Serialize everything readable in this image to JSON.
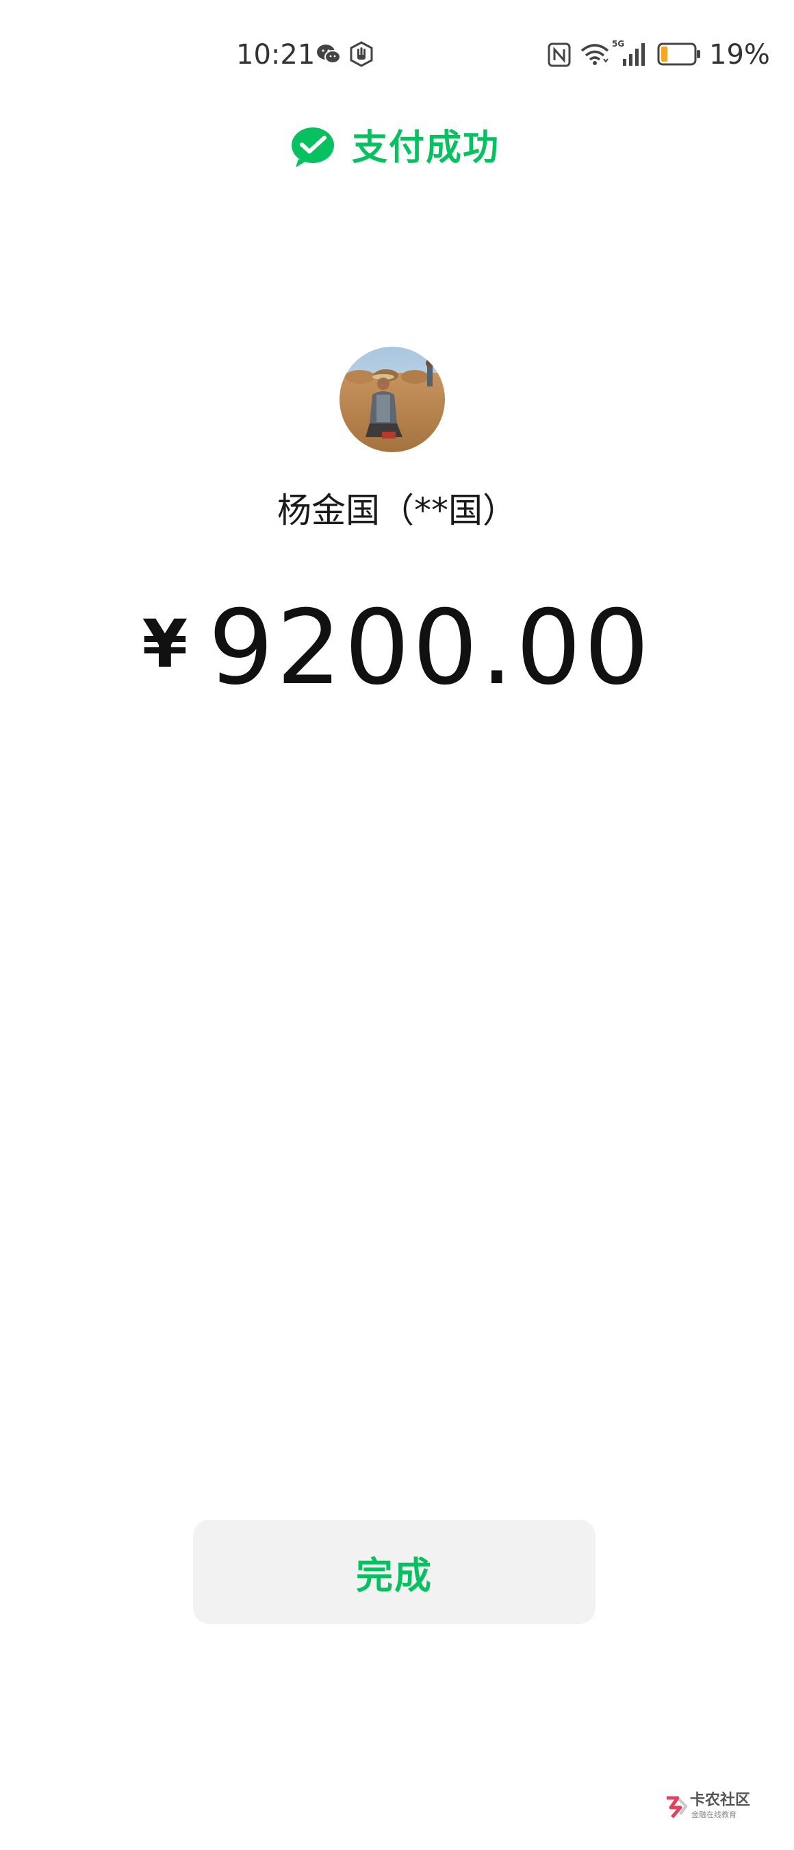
{
  "status_bar": {
    "time": "10:21",
    "battery_percent": "19%",
    "battery_level": 0.19,
    "network": "5G",
    "icons": [
      "wechat-icon",
      "hand-icon",
      "nfc-icon",
      "wifi-icon",
      "signal-icon",
      "battery-icon"
    ]
  },
  "header": {
    "title": "支付成功",
    "icon": "check-circle-icon"
  },
  "payee": {
    "name": "杨金国（**国）"
  },
  "payment": {
    "currency_symbol": "¥",
    "amount": "9200.00"
  },
  "actions": {
    "done_label": "完成"
  },
  "watermark": {
    "title": "卡农社区",
    "subtitle": "金融在线教育"
  },
  "colors": {
    "accent": "#07c160",
    "button_bg": "#f2f2f2",
    "text": "#111111",
    "battery_low": "#f5a623"
  }
}
